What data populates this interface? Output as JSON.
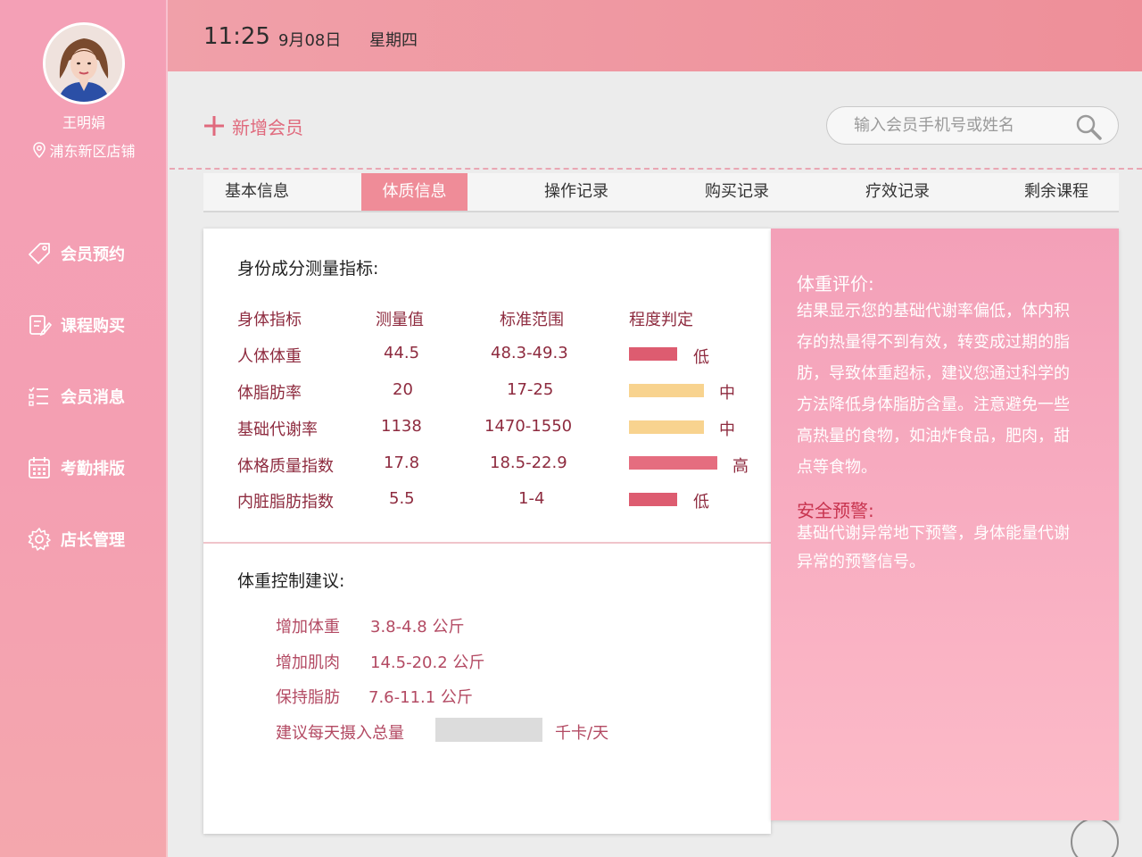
{
  "profile": {
    "name": "王明娟",
    "location": "浦东新区店铺"
  },
  "nav": {
    "items": [
      {
        "label": "会员预约",
        "icon": "tag-icon"
      },
      {
        "label": "课程购买",
        "icon": "edit-doc-icon"
      },
      {
        "label": "会员消息",
        "icon": "list-icon"
      },
      {
        "label": "考勤排版",
        "icon": "calendar-icon"
      },
      {
        "label": "店长管理",
        "icon": "gear-icon"
      }
    ]
  },
  "header": {
    "time": "11:25",
    "date": "9月08日",
    "weekday": "星期四"
  },
  "toolbar": {
    "add_member_label": "新增会员",
    "search_placeholder": "输入会员手机号或姓名"
  },
  "tabs": {
    "items": [
      "基本信息",
      "体质信息",
      "操作记录",
      "购买记录",
      "疗效记录",
      "剩余课程"
    ],
    "active": "体质信息"
  },
  "body_composition": {
    "title": "身份成分测量指标:",
    "columns": [
      "身体指标",
      "测量值",
      "标准范围",
      "程度判定"
    ],
    "rows": [
      {
        "name": "人体体重",
        "value": "44.5",
        "range": "48.3-49.3",
        "level": "低",
        "bar_color": "#dd5c70",
        "bar_fraction": 0.35
      },
      {
        "name": "体脂肪率",
        "value": "20",
        "range": "17-25",
        "level": "中",
        "bar_color": "#f8d38f",
        "bar_fraction": 0.55
      },
      {
        "name": "基础代谢率",
        "value": "1138",
        "range": "1470-1550",
        "level": "中",
        "bar_color": "#f8d38f",
        "bar_fraction": 0.55
      },
      {
        "name": "体格质量指数",
        "value": "17.8",
        "range": "18.5-22.9",
        "level": "高",
        "bar_color": "#e56d7f",
        "bar_fraction": 0.65
      },
      {
        "name": "内脏脂肪指数",
        "value": "5.5",
        "range": "1-4",
        "level": "低",
        "bar_color": "#dd5c70",
        "bar_fraction": 0.35
      }
    ]
  },
  "weight_advice": {
    "title": "体重控制建议:",
    "items": [
      {
        "label": "增加体重",
        "value": "3.8-4.8 公斤"
      },
      {
        "label": "增加肌肉",
        "value": "14.5-20.2 公斤"
      },
      {
        "label": "保持脂肪",
        "value": "7.6-11.1 公斤"
      }
    ],
    "intake_label": "建议每天摄入总量",
    "intake_unit": "千卡/天"
  },
  "evaluation": {
    "weight_title": "体重评价:",
    "weight_lines": [
      "结果显示您的基础代谢率偏低，体内积",
      "存的热量得不到有效，转变成过期的脂",
      "肪，导致体重超标，建议您通过科学的",
      "方法降低身体脂肪含量。注意避免一些",
      "高热量的食物，如油炸食品，肥肉，甜",
      "点等食物。"
    ],
    "warning_title": "安全预警:",
    "warning_lines": [
      "基础代谢异常地下预警，身体能量代谢",
      "异常的预警信号。"
    ]
  },
  "colors": {
    "accent": "#ef8c98",
    "sidebar_top": "#f4a0b6",
    "text_dark_red": "#8e2b3f",
    "warning_title": "#c8344f"
  }
}
